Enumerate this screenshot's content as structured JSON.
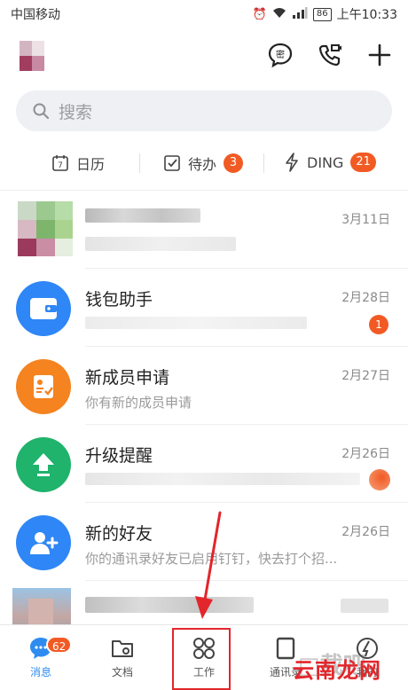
{
  "status_bar": {
    "carrier": "中国移动",
    "battery": "86",
    "time": "上午10:33"
  },
  "search": {
    "placeholder": "搜索"
  },
  "quick": {
    "calendar_label": "日历",
    "calendar_day": "7",
    "todo_label": "待办",
    "todo_count": "3",
    "ding_label": "DING",
    "ding_count": "21"
  },
  "header_icons": {
    "chat_bubble_glyph": "密"
  },
  "chats": [
    {
      "title": "",
      "subtitle": "",
      "time": "3月11日",
      "icon": "blurred-group-avatar",
      "blurred": true
    },
    {
      "title": "钱包助手",
      "subtitle": "",
      "time": "2月28日",
      "badge": "1",
      "icon": "wallet-icon",
      "color": "#2f86f6"
    },
    {
      "title": "新成员申请",
      "subtitle": "你有新的成员申请",
      "time": "2月27日",
      "icon": "clipboard-check-icon",
      "color": "#f5831f"
    },
    {
      "title": "升级提醒",
      "subtitle": "",
      "time": "2月26日",
      "icon": "upgrade-arrow-icon",
      "color": "#1fb36b"
    },
    {
      "title": "新的好友",
      "subtitle": "你的通讯录好友已启用钉钉，快去打个招...",
      "time": "2月26日",
      "icon": "add-friend-icon",
      "color": "#2f86f6"
    },
    {
      "title": "",
      "subtitle": "",
      "time": "",
      "icon": "blurred-person-avatar",
      "blurred": true
    }
  ],
  "tabs": [
    {
      "label": "消息",
      "badge": "62",
      "icon": "message-bubble-icon",
      "active": true
    },
    {
      "label": "文档",
      "icon": "folder-icon"
    },
    {
      "label": "工作",
      "icon": "grid-apps-icon"
    },
    {
      "label": "通讯录",
      "icon": "contacts-icon"
    },
    {
      "label": "我的",
      "icon": "profile-icon"
    }
  ],
  "watermark": {
    "text": "云南龙网"
  },
  "colors": {
    "accent": "#2e8cf0",
    "badge": "#f25a24",
    "highlight": "#e2262b"
  }
}
